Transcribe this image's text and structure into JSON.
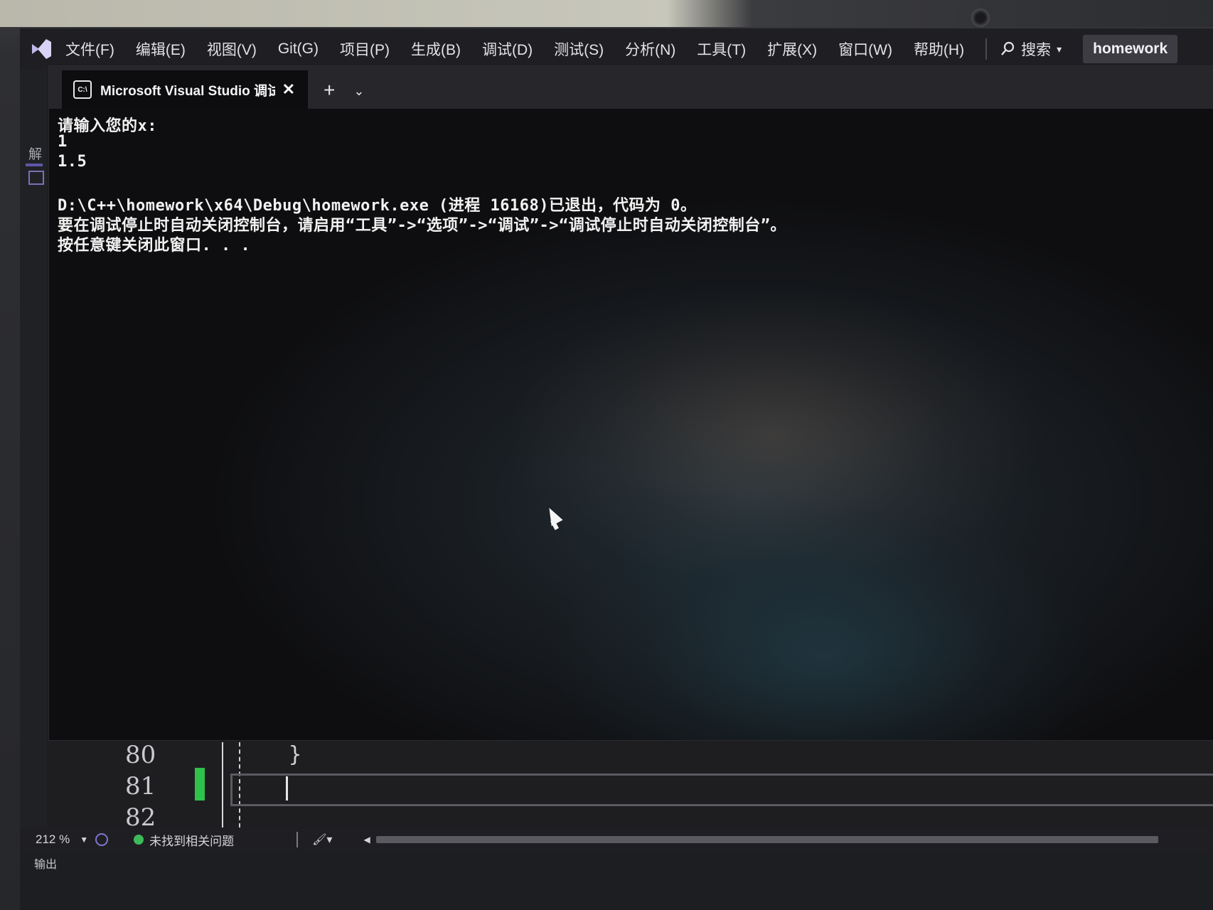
{
  "menu": {
    "items": [
      "文件(F)",
      "编辑(E)",
      "视图(V)",
      "Git(G)",
      "项目(P)",
      "生成(B)",
      "调试(D)",
      "测试(S)",
      "分析(N)",
      "工具(T)",
      "扩展(X)",
      "窗口(W)",
      "帮助(H)"
    ],
    "search_label": "搜索",
    "project_name": "homework"
  },
  "left_panel": {
    "label": "解"
  },
  "console": {
    "tab_title": "Microsoft Visual Studio 调试",
    "tab_icon_text": "C:\\",
    "lines": [
      "请输入您的x:",
      "1",
      "1.5",
      "",
      "D:\\C++\\homework\\x64\\Debug\\homework.exe (进程 16168)已退出，代码为 0。",
      "要在调试停止时自动关闭控制台，请启用“工具”->“选项”->“调试”->“调试停止时自动关闭控制台”。",
      "按任意键关闭此窗口. . ."
    ]
  },
  "editor": {
    "line_numbers": [
      "80",
      "81",
      "82"
    ],
    "code_line_80": "}"
  },
  "status": {
    "zoom": "212 %",
    "issues": "未找到相关问题",
    "output_tab": "输出"
  },
  "colors": {
    "accent_green": "#2ec24a",
    "issue_ok": "#3dbb5a"
  }
}
